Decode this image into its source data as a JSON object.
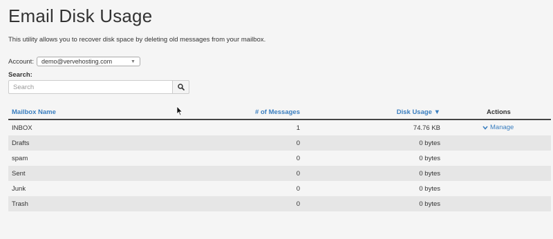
{
  "page": {
    "title": "Email Disk Usage",
    "description": "This utility allows you to recover disk space by deleting old messages from your mailbox."
  },
  "account": {
    "label": "Account:",
    "selected": "demo@vervehosting.com"
  },
  "search": {
    "label": "Search:",
    "placeholder": "Search",
    "value": ""
  },
  "table": {
    "headers": {
      "name": "Mailbox Name",
      "messages": "# of Messages",
      "usage": "Disk Usage ▼",
      "actions": "Actions"
    },
    "rows": [
      {
        "name": "INBOX",
        "messages": "1",
        "usage": "74.76 KB",
        "action": "Manage"
      },
      {
        "name": "Drafts",
        "messages": "0",
        "usage": "0 bytes",
        "action": ""
      },
      {
        "name": "spam",
        "messages": "0",
        "usage": "0 bytes",
        "action": ""
      },
      {
        "name": "Sent",
        "messages": "0",
        "usage": "0 bytes",
        "action": ""
      },
      {
        "name": "Junk",
        "messages": "0",
        "usage": "0 bytes",
        "action": ""
      },
      {
        "name": "Trash",
        "messages": "0",
        "usage": "0 bytes",
        "action": ""
      }
    ]
  },
  "colors": {
    "link": "#3a7ebf",
    "alt_row": "#e6e6e6",
    "background": "#f5f5f5"
  },
  "icons": {
    "search": "magnifier-icon",
    "select_caret": "caret-down-icon",
    "manage": "chevron-down-icon",
    "pointer": "mouse-cursor-icon"
  }
}
